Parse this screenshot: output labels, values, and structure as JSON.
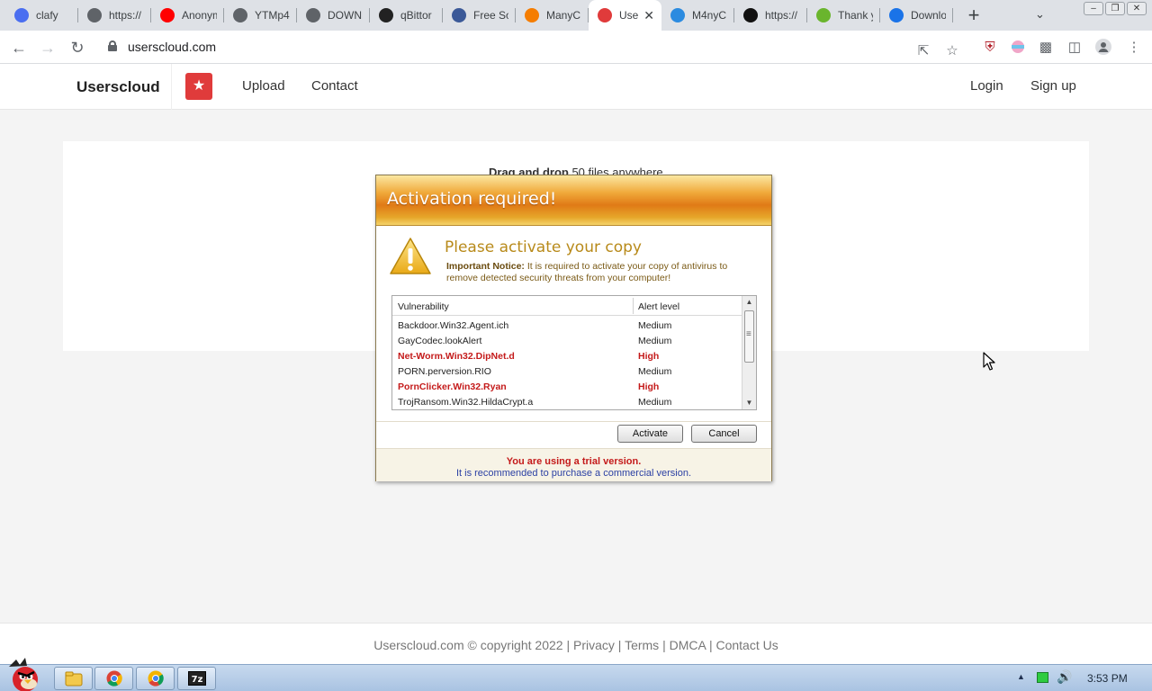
{
  "browser": {
    "tabs": [
      {
        "title": "clafy",
        "icon": "clafy-icon",
        "color": "#4a6ef0"
      },
      {
        "title": "https://",
        "icon": "globe-icon",
        "color": "#5f6368"
      },
      {
        "title": "Anonym",
        "icon": "youtube-icon",
        "color": "#ff0000"
      },
      {
        "title": "YTMp4",
        "icon": "globe-icon",
        "color": "#5f6368"
      },
      {
        "title": "DOWNL",
        "icon": "globe-icon",
        "color": "#5f6368"
      },
      {
        "title": "qBittor",
        "icon": "qbittorrent-icon",
        "color": "#222222"
      },
      {
        "title": "Free So",
        "icon": "grid-icon",
        "color": "#3b5998"
      },
      {
        "title": "ManyC",
        "icon": "blogger-icon",
        "color": "#f57d00"
      },
      {
        "title": "Use",
        "icon": "userscloud-icon",
        "color": "#e03b3b"
      },
      {
        "title": "M4nyC",
        "icon": "m4ny-icon",
        "color": "#2b8be0"
      },
      {
        "title": "https://",
        "icon": "terminal-icon",
        "color": "#111111"
      },
      {
        "title": "Thank y",
        "icon": "utorrent-icon",
        "color": "#6ab52d"
      },
      {
        "title": "Downlo",
        "icon": "download-icon",
        "color": "#1a73e8"
      }
    ],
    "active_tab_index": 8,
    "url": "userscloud.com"
  },
  "site": {
    "brand": "Userscloud",
    "nav": {
      "upload": "Upload",
      "contact": "Contact",
      "login": "Login",
      "signup": "Sign up"
    },
    "drag_bold": "Drag and drop",
    "drag_rest": " 50 files anywhere",
    "footer": {
      "copyright": "Userscloud.com © copyright 2022",
      "links": [
        "Privacy",
        "Terms",
        "DMCA",
        "Contact Us"
      ]
    }
  },
  "dialog": {
    "title": "Activation required!",
    "heading": "Please activate your copy",
    "notice_bold": "Important Notice:",
    "notice_text": " It is required to activate your copy of antivirus to remove detected security threats from your computer!",
    "columns": [
      "Vulnerability",
      "Alert level"
    ],
    "rows": [
      {
        "name": "Backdoor.Win32.Agent.ich",
        "level": "Medium",
        "severity": "medium"
      },
      {
        "name": "GayCodec.lookAlert",
        "level": "Medium",
        "severity": "medium"
      },
      {
        "name": "Net-Worm.Win32.DipNet.d",
        "level": "High",
        "severity": "high"
      },
      {
        "name": "PORN.perversion.RIO",
        "level": "Medium",
        "severity": "medium"
      },
      {
        "name": "PornClicker.Win32.Ryan",
        "level": "High",
        "severity": "high"
      },
      {
        "name": "TrojRansom.Win32.HildaCrypt.a",
        "level": "Medium",
        "severity": "medium"
      }
    ],
    "activate_label": "Activate",
    "cancel_label": "Cancel",
    "trial_line": "You are using a trial version.",
    "recommend_line": "It is recommended to purchase a commercial version."
  },
  "taskbar": {
    "clock": "3:53 PM",
    "pinned": [
      "explorer-icon",
      "chrome-icon",
      "chrome-alt-icon",
      "7zip-icon"
    ]
  },
  "colors": {
    "accent_red": "#e03b3b",
    "high_alert": "#c41a1a",
    "dialog_title": "#e07a16"
  }
}
